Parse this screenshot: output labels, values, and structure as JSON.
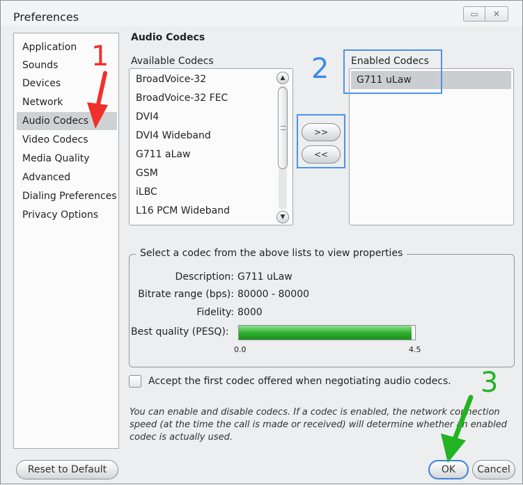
{
  "window": {
    "title": "Preferences",
    "minimize_glyph": "▭",
    "close_glyph": "✕"
  },
  "sidebar": {
    "items": [
      {
        "label": "Application"
      },
      {
        "label": "Sounds"
      },
      {
        "label": "Devices"
      },
      {
        "label": "Network"
      },
      {
        "label": "Audio Codecs",
        "selected": true
      },
      {
        "label": "Video Codecs"
      },
      {
        "label": "Media Quality"
      },
      {
        "label": "Advanced"
      },
      {
        "label": "Dialing Preferences"
      },
      {
        "label": "Privacy Options"
      }
    ]
  },
  "main": {
    "section_title": "Audio Codecs",
    "available": {
      "label": "Available Codecs",
      "items": [
        "BroadVoice-32",
        "BroadVoice-32 FEC",
        "DVI4",
        "DVI4 Wideband",
        "G711 aLaw",
        "GSM",
        "iLBC",
        "L16 PCM Wideband"
      ]
    },
    "enabled": {
      "label": "Enabled Codecs",
      "items": [
        "G711 uLaw"
      ]
    },
    "add_button": ">>",
    "remove_button": "<<",
    "properties": {
      "legend": "Select a codec from the above lists to view properties",
      "description_label": "Description:",
      "description_value": "G711 uLaw",
      "bitrate_label": "Bitrate range (bps):",
      "bitrate_value": "80000 - 80000",
      "fidelity_label": "Fidelity:",
      "fidelity_value": "8000",
      "quality_label": "Best quality (PESQ):",
      "quality_min": "0.0",
      "quality_max": "4.5",
      "quality_fraction": 0.98
    },
    "accept_first_label": "Accept the first codec offered when negotiating audio codecs.",
    "accept_first_checked": false,
    "note": "You can enable and disable codecs. If a codec is enabled, the network connection speed (at the time the call is made or received) will determine whether an enabled codec is actually used."
  },
  "footer": {
    "reset_label": "Reset to Default",
    "ok_label": "OK",
    "cancel_label": "Cancel"
  },
  "annotations": {
    "step1": "1",
    "step2": "2",
    "step3": "3",
    "red": "#f0302a",
    "blue": "#3d8be8",
    "green": "#22b422"
  }
}
